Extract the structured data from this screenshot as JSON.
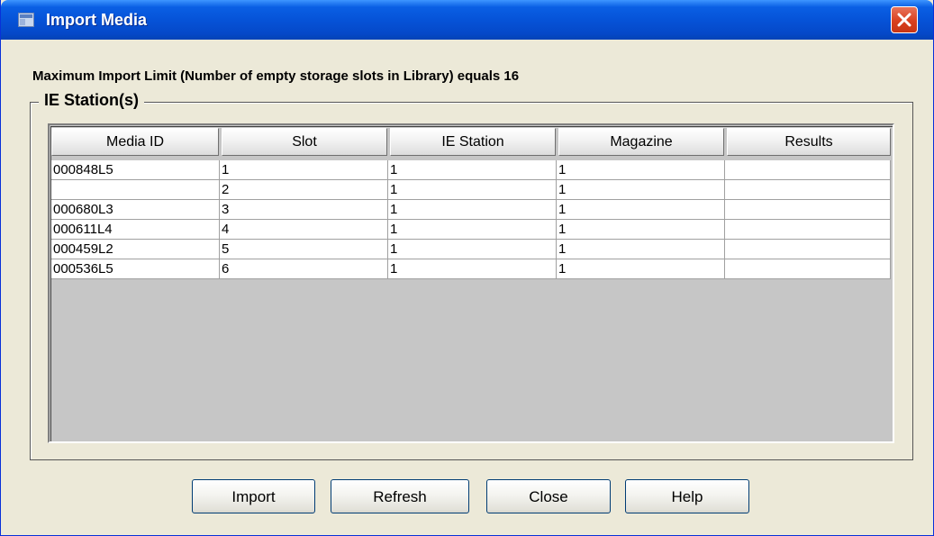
{
  "window": {
    "title": "Import Media",
    "icon": "app-window-icon",
    "close_icon": "close-x-icon"
  },
  "limit_text": "Maximum Import Limit (Number of empty storage slots in Library) equals 16",
  "group_title": "IE Station(s)",
  "table": {
    "columns": [
      "Media ID",
      "Slot",
      "IE Station",
      "Magazine",
      "Results"
    ],
    "rows": [
      {
        "media_id": "000848L5",
        "slot": "1",
        "ie_station": "1",
        "magazine": "1",
        "results": ""
      },
      {
        "media_id": "",
        "slot": "2",
        "ie_station": "1",
        "magazine": "1",
        "results": ""
      },
      {
        "media_id": "000680L3",
        "slot": "3",
        "ie_station": "1",
        "magazine": "1",
        "results": ""
      },
      {
        "media_id": "000611L4",
        "slot": "4",
        "ie_station": "1",
        "magazine": "1",
        "results": ""
      },
      {
        "media_id": "000459L2",
        "slot": "5",
        "ie_station": "1",
        "magazine": "1",
        "results": ""
      },
      {
        "media_id": "000536L5",
        "slot": "6",
        "ie_station": "1",
        "magazine": "1",
        "results": ""
      }
    ]
  },
  "buttons": {
    "import": "Import",
    "refresh": "Refresh",
    "close": "Close",
    "help": "Help"
  },
  "colors": {
    "titlebar": "#0653d8",
    "window_bg": "#ece9d8",
    "close_button": "#d9401f",
    "table_bg": "#c6c6c6"
  }
}
